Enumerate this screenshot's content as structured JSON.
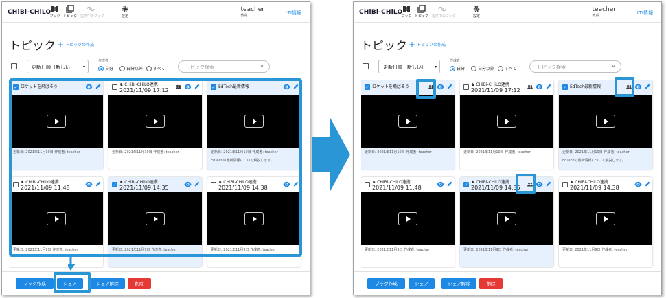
{
  "colors": {
    "accent": "#1e88e5",
    "highlight": "#2a96d6",
    "danger": "#e53935",
    "selected_bg": "#e7f1fd"
  },
  "app": {
    "logo": "CHiBi-CHiLO"
  },
  "nav": [
    {
      "label": "ブック",
      "icon": "book-icon"
    },
    {
      "label": "トピック",
      "icon": "topic-icon"
    },
    {
      "label": "提供中のブック",
      "icon": "link-icon"
    },
    {
      "label": "設定",
      "icon": "gear-icon"
    }
  ],
  "user": {
    "name": "teacher",
    "role": "教員"
  },
  "lti_label": "LTI情報",
  "page": {
    "title": "トピック",
    "add_topic": "トピックの作成"
  },
  "filters": {
    "sort_value": "更新日順（新しい）",
    "creator_label": "作成者",
    "creator_options": [
      "自分",
      "自分以外",
      "すべて"
    ],
    "creator_selected": "自分",
    "search_placeholder": "トピック検索"
  },
  "cards": [
    {
      "title": "ロケットを飛ばそう",
      "subtitle": "",
      "checked": true,
      "shared": true,
      "meta": "更新日: 2021年11月10日   作成者: teacher",
      "desc": ""
    },
    {
      "title": "CHiBi-CHiLO連携",
      "subtitle": "2021/11/09 17:12",
      "checked": false,
      "shared": true,
      "meta": "更新日: 2021年11月10日   作成者: teacher",
      "desc": ""
    },
    {
      "title": "EdTech最新情報",
      "subtitle": "",
      "checked": true,
      "shared": true,
      "meta": "更新日: 2021年11月10日   作成者: teacher",
      "desc": "EdTechの最新情報について解説します。"
    },
    {
      "title": "CHiBi-CHiLO連携",
      "subtitle": "2021/11/09 11:48",
      "checked": false,
      "shared": false,
      "meta": "更新日: 2021年11月9日   作成者: teacher",
      "desc": ""
    },
    {
      "title": "CHiBi-CHiLO連携",
      "subtitle": "2021/11/09 14:35",
      "checked": true,
      "shared": true,
      "meta": "更新日: 2021年11月9日   作成者: teacher",
      "desc": ""
    },
    {
      "title": "CHiBi-CHiLO連携",
      "subtitle": "2021/11/09 14:38",
      "checked": false,
      "shared": false,
      "meta": "更新日: 2021年11月9日   作成者: teacher",
      "desc": ""
    }
  ],
  "before_shared_flags": [
    false,
    true,
    false,
    false,
    false,
    false
  ],
  "actions": {
    "create_book": "ブック作成",
    "share": "シェア",
    "unshare": "シェア解除",
    "delete": "削除"
  }
}
